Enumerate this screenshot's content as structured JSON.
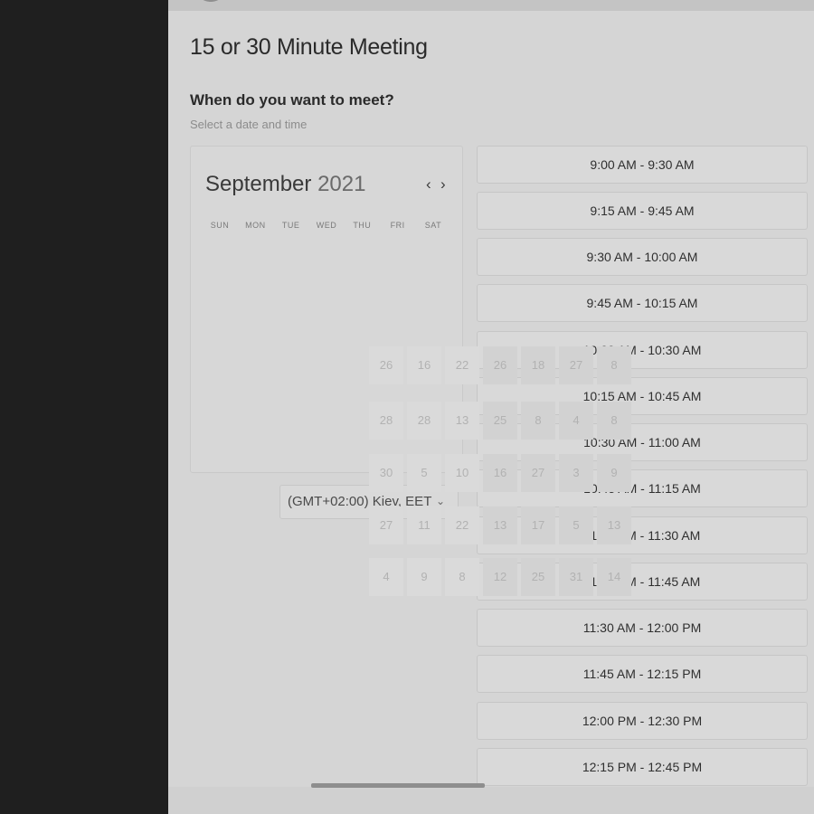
{
  "meeting": {
    "title": "15 or 30 Minute Meeting",
    "question": "When do you want to meet?",
    "hint": "Select a date and time"
  },
  "calendar": {
    "month": "September",
    "year": "2021",
    "prev_icon": "chevron-left-icon",
    "next_icon": "chevron-right-icon",
    "prev_glyph": "‹",
    "next_glyph": "›",
    "weekdays": [
      "SUN",
      "MON",
      "TUE",
      "WED",
      "THU",
      "FRI",
      "SAT"
    ]
  },
  "timezone": {
    "value": "(GMT+02:00) Kiev, EET",
    "chevron_glyph": "⌄"
  },
  "slots": [
    "9:00 AM - 9:30 AM",
    "9:15 AM - 9:45 AM",
    "9:30 AM - 10:00 AM",
    "9:45 AM - 10:15 AM",
    "10:00 AM - 10:30 AM",
    "10:15 AM - 10:45 AM",
    "10:30 AM - 11:00 AM",
    "10:45 AM - 11:15 AM",
    "11:00 AM - 11:30 AM",
    "11:15 AM - 11:45 AM",
    "11:30 AM - 12:00 PM",
    "11:45 AM - 12:15 PM",
    "12:00 PM - 12:30 PM",
    "12:15 PM - 12:45 PM"
  ],
  "glitch_rows": [
    [
      "26",
      "16",
      "22",
      "26",
      "18",
      "27",
      "8"
    ],
    [
      "28",
      "28",
      "13",
      "25",
      "8",
      "4",
      "8"
    ],
    [
      "30",
      "5",
      "10",
      "16",
      "27",
      "3",
      "9"
    ],
    [
      "27",
      "11",
      "22",
      "13",
      "17",
      "5",
      "13"
    ],
    [
      "4",
      "9",
      "8",
      "12",
      "25",
      "31",
      "14"
    ]
  ],
  "colors": {
    "panel": "#d5d5d5",
    "rail": "#1f1f1f",
    "text": "#2a2a2a"
  }
}
